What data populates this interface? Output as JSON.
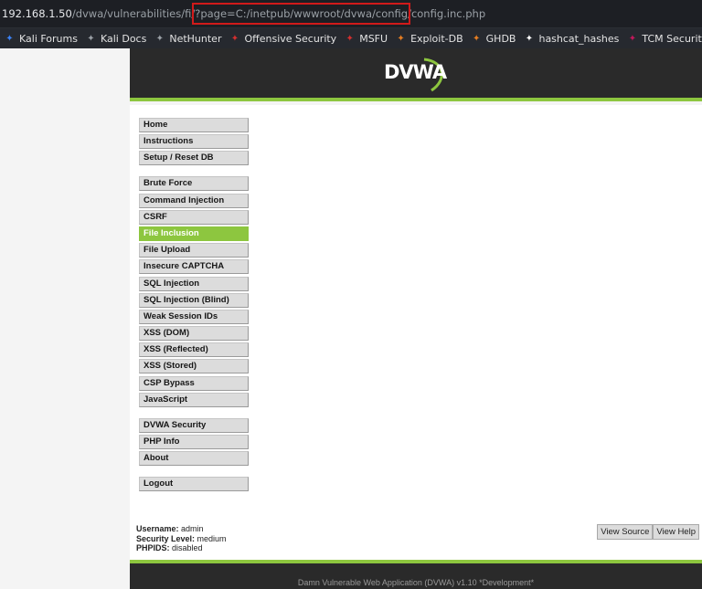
{
  "browser": {
    "url_host": "192.168.1.50",
    "url_path": "/dvwa/vulnerabilities/fi/?page=",
    "url_param": "C:/inetpub/wwwroot/dvwa/config/config.inc.php",
    "highlight_color": "#d11a1a"
  },
  "bookmarks": [
    {
      "label": "Kali Forums",
      "icon": "kali-forums-icon",
      "color": "#3b82f6"
    },
    {
      "label": "Kali Docs",
      "icon": "kali-docs-icon",
      "color": "#9aa0a6"
    },
    {
      "label": "NetHunter",
      "icon": "nethunter-icon",
      "color": "#9aa0a6"
    },
    {
      "label": "Offensive Security",
      "icon": "offsec-icon",
      "color": "#d32f2f"
    },
    {
      "label": "MSFU",
      "icon": "msfu-icon",
      "color": "#d32f2f"
    },
    {
      "label": "Exploit-DB",
      "icon": "exploit-db-icon",
      "color": "#e67e22"
    },
    {
      "label": "GHDB",
      "icon": "ghdb-icon",
      "color": "#e67e22"
    },
    {
      "label": "hashcat_hashes",
      "icon": "hashcat-icon",
      "color": "#ffffff"
    },
    {
      "label": "TCM Security, Inc.",
      "icon": "tcm-icon",
      "color": "#c2185b"
    }
  ],
  "header": {
    "logo_text": "DVWA"
  },
  "menu": {
    "group1": [
      "Home",
      "Instructions",
      "Setup / Reset DB"
    ],
    "group2": [
      "Brute Force",
      "Command Injection",
      "CSRF",
      "File Inclusion",
      "File Upload",
      "Insecure CAPTCHA",
      "SQL Injection",
      "SQL Injection (Blind)",
      "Weak Session IDs",
      "XSS (DOM)",
      "XSS (Reflected)",
      "XSS (Stored)",
      "CSP Bypass",
      "JavaScript"
    ],
    "group3": [
      "DVWA Security",
      "PHP Info",
      "About"
    ],
    "group4": [
      "Logout"
    ],
    "active": "File Inclusion",
    "accent_color": "#8dc63f"
  },
  "userinfo": {
    "username_label": "Username:",
    "username": "admin",
    "security_label": "Security Level:",
    "security": "medium",
    "phpids_label": "PHPIDS:",
    "phpids": "disabled"
  },
  "buttons": {
    "view_source": "View Source",
    "view_help": "View Help"
  },
  "footer": {
    "text": "Damn Vulnerable Web Application (DVWA) v1.10 *Development*"
  }
}
